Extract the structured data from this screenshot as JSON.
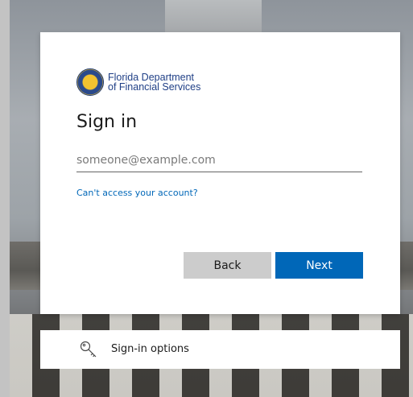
{
  "logo": {
    "line1": "Florida Department",
    "line2": "of Financial Services"
  },
  "signin": {
    "title": "Sign in",
    "email_placeholder": "someone@example.com",
    "email_value": "",
    "cant_access_label": "Can't access your account?",
    "back_label": "Back",
    "next_label": "Next"
  },
  "options": {
    "label": "Sign-in options",
    "icon": "key-icon"
  },
  "colors": {
    "accent": "#0067b8",
    "back_button": "#cccccc",
    "logo_text": "#1f3f86"
  }
}
